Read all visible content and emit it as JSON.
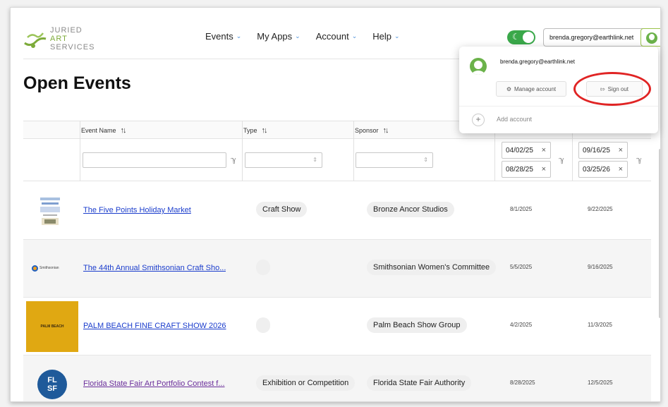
{
  "logo": {
    "line1": "JURIED",
    "line2": "ART",
    "line3": "SERVICES"
  },
  "nav": [
    {
      "label": "Events"
    },
    {
      "label": "My Apps"
    },
    {
      "label": "Account"
    },
    {
      "label": "Help"
    }
  ],
  "header": {
    "user_email": "brenda.gregory@earthlink.net",
    "theme_icon": "moon-icon"
  },
  "page_title": "Open Events",
  "table": {
    "columns": [
      "Event Name",
      "Type",
      "Sponsor"
    ],
    "date_filters": {
      "start": [
        "04/02/25",
        "08/28/25"
      ],
      "end": [
        "09/16/25",
        "03/25/26"
      ]
    },
    "rows": [
      {
        "name": "The Five Points Holiday Market",
        "type": "Craft Show",
        "sponsor": "Bronze Ancor Studios",
        "start": "8/1/2025",
        "end": "9/22/2025"
      },
      {
        "name": "The 44th Annual Smithsonian Craft Sho...",
        "type": "",
        "sponsor": "Smithsonian Women's Committee",
        "start": "5/5/2025",
        "end": "9/16/2025"
      },
      {
        "name": "PALM BEACH FINE CRAFT SHOW 2026",
        "type": "",
        "sponsor": "Palm Beach Show Group",
        "start": "4/2/2025",
        "end": "11/3/2025"
      },
      {
        "name": "Florida State Fair Art Portfolio Contest f...",
        "type": "Exhibition or Competition",
        "sponsor": "Florida State Fair Authority",
        "start": "8/28/2025",
        "end": "12/5/2025"
      }
    ],
    "thumb_labels": {
      "palm_beach": "PALM BEACH",
      "fl": "FL",
      "sf": "SF",
      "smithsonian": "Smithsonian"
    }
  },
  "account_menu": {
    "email": "brenda.gregory@earthlink.net",
    "manage_label": "Manage account",
    "signout_label": "Sign out",
    "add_label": "Add account"
  }
}
